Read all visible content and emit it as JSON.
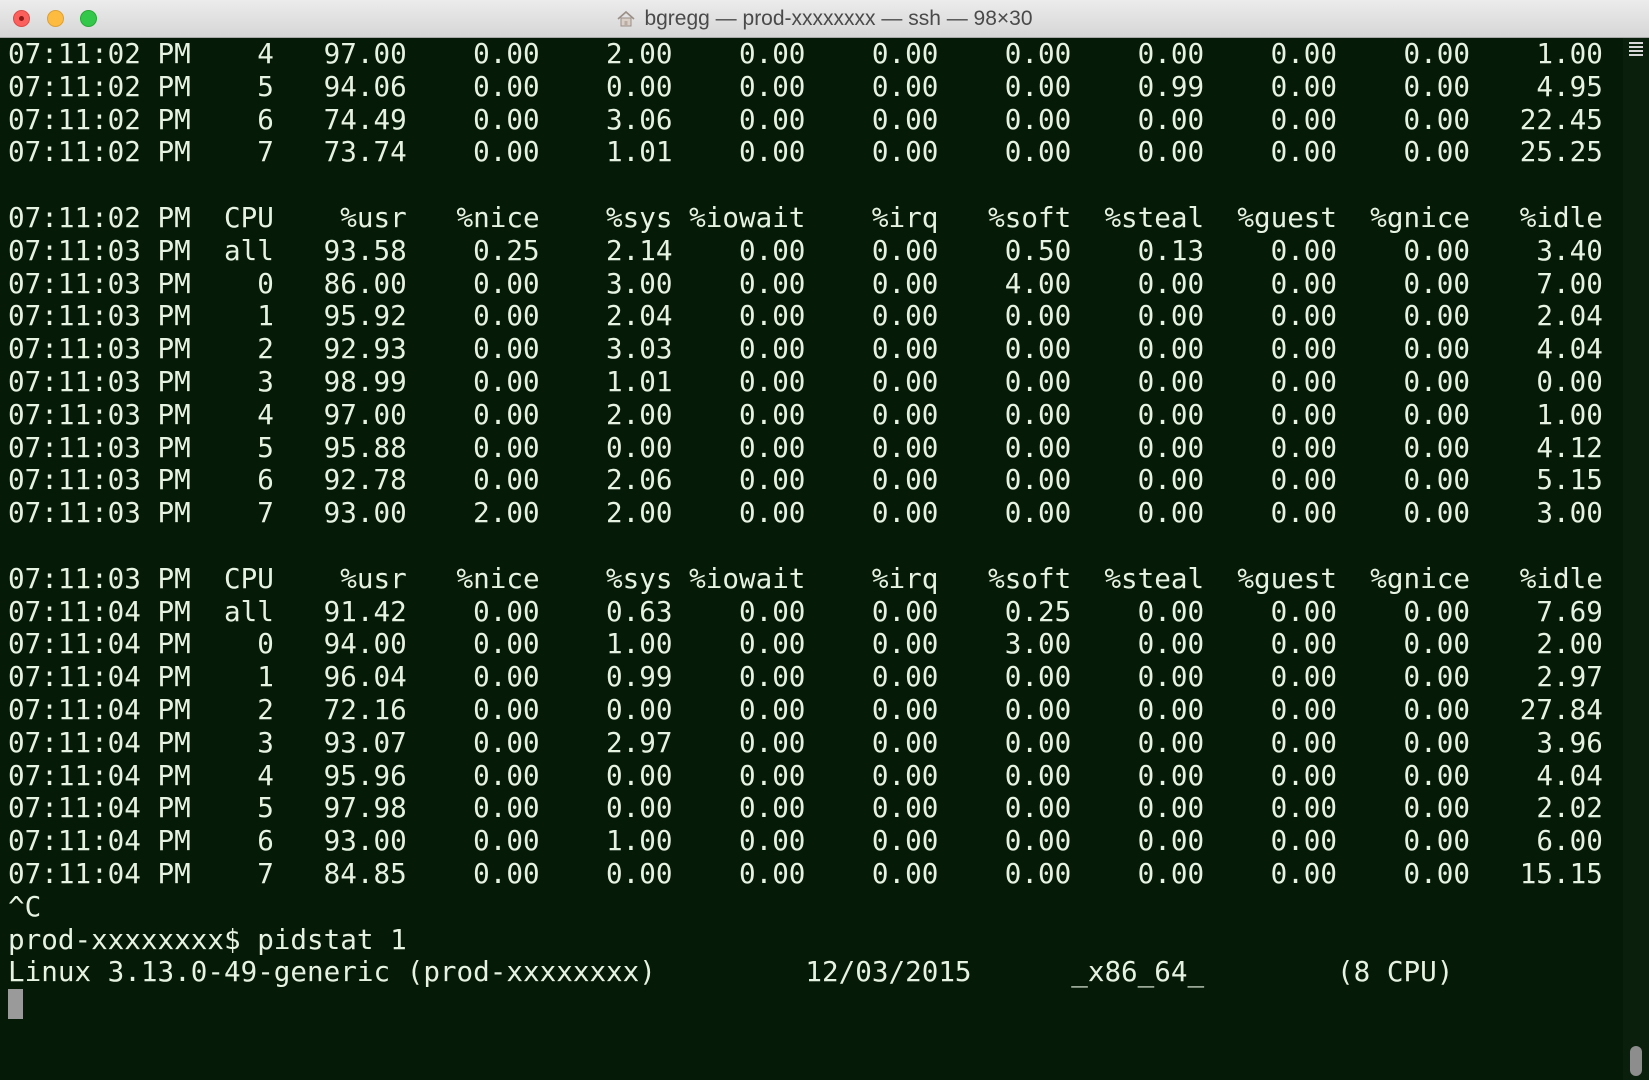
{
  "window": {
    "title": "bgregg — prod-xxxxxxxx — ssh — 98×30",
    "home_icon": "house-icon",
    "colors": {
      "background": "#061a08",
      "text": "#e6f2e2"
    }
  },
  "terminal": {
    "lines": [
      "07:11:02 PM    4   97.00    0.00    2.00    0.00    0.00    0.00    0.00    0.00    0.00    1.00",
      "07:11:02 PM    5   94.06    0.00    0.00    0.00    0.00    0.00    0.99    0.00    0.00    4.95",
      "07:11:02 PM    6   74.49    0.00    3.06    0.00    0.00    0.00    0.00    0.00    0.00   22.45",
      "07:11:02 PM    7   73.74    0.00    1.01    0.00    0.00    0.00    0.00    0.00    0.00   25.25",
      "",
      "07:11:02 PM  CPU    %usr   %nice    %sys %iowait    %irq   %soft  %steal  %guest  %gnice   %idle",
      "07:11:03 PM  all   93.58    0.25    2.14    0.00    0.00    0.50    0.13    0.00    0.00    3.40",
      "07:11:03 PM    0   86.00    0.00    3.00    0.00    0.00    4.00    0.00    0.00    0.00    7.00",
      "07:11:03 PM    1   95.92    0.00    2.04    0.00    0.00    0.00    0.00    0.00    0.00    2.04",
      "07:11:03 PM    2   92.93    0.00    3.03    0.00    0.00    0.00    0.00    0.00    0.00    4.04",
      "07:11:03 PM    3   98.99    0.00    1.01    0.00    0.00    0.00    0.00    0.00    0.00    0.00",
      "07:11:03 PM    4   97.00    0.00    2.00    0.00    0.00    0.00    0.00    0.00    0.00    1.00",
      "07:11:03 PM    5   95.88    0.00    0.00    0.00    0.00    0.00    0.00    0.00    0.00    4.12",
      "07:11:03 PM    6   92.78    0.00    2.06    0.00    0.00    0.00    0.00    0.00    0.00    5.15",
      "07:11:03 PM    7   93.00    2.00    2.00    0.00    0.00    0.00    0.00    0.00    0.00    3.00",
      "",
      "07:11:03 PM  CPU    %usr   %nice    %sys %iowait    %irq   %soft  %steal  %guest  %gnice   %idle",
      "07:11:04 PM  all   91.42    0.00    0.63    0.00    0.00    0.25    0.00    0.00    0.00    7.69",
      "07:11:04 PM    0   94.00    0.00    1.00    0.00    0.00    3.00    0.00    0.00    0.00    2.00",
      "07:11:04 PM    1   96.04    0.00    0.99    0.00    0.00    0.00    0.00    0.00    0.00    2.97",
      "07:11:04 PM    2   72.16    0.00    0.00    0.00    0.00    0.00    0.00    0.00    0.00   27.84",
      "07:11:04 PM    3   93.07    0.00    2.97    0.00    0.00    0.00    0.00    0.00    0.00    3.96",
      "07:11:04 PM    4   95.96    0.00    0.00    0.00    0.00    0.00    0.00    0.00    0.00    4.04",
      "07:11:04 PM    5   97.98    0.00    0.00    0.00    0.00    0.00    0.00    0.00    0.00    2.02",
      "07:11:04 PM    6   93.00    0.00    1.00    0.00    0.00    0.00    0.00    0.00    0.00    6.00",
      "07:11:04 PM    7   84.85    0.00    0.00    0.00    0.00    0.00    0.00    0.00    0.00   15.15",
      "^C",
      "prod-xxxxxxxx$ pidstat 1",
      "Linux 3.13.0-49-generic (prod-xxxxxxxx)         12/03/2015      _x86_64_        (8 CPU)"
    ]
  }
}
